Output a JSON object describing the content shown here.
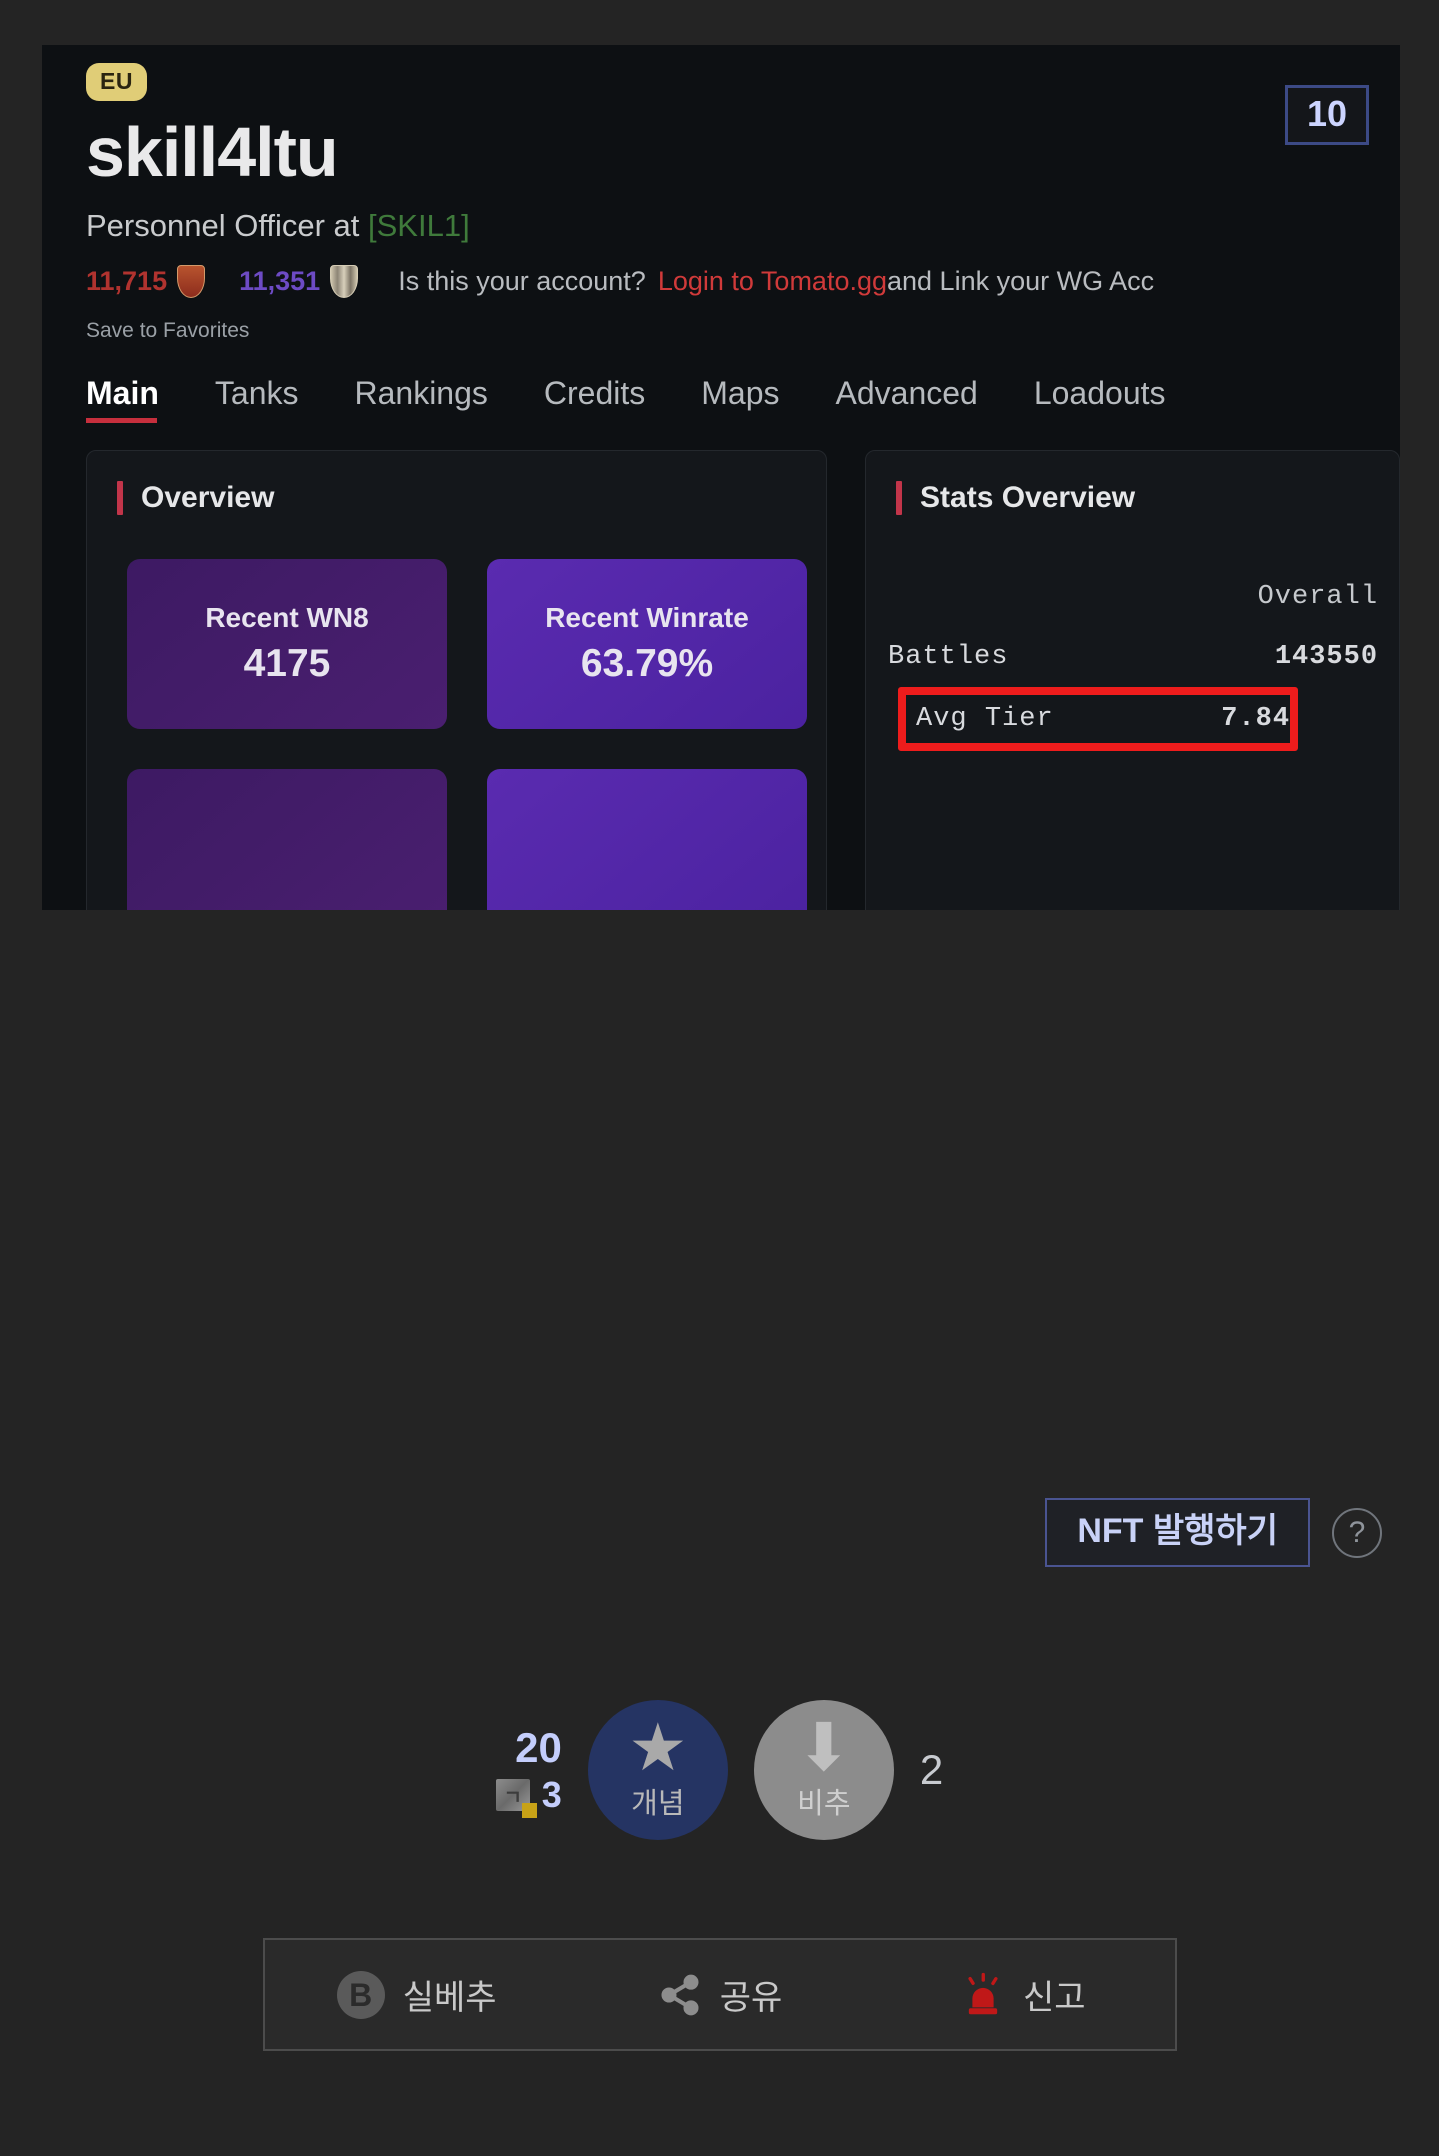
{
  "embedded_page": {
    "region_badge": "EU",
    "player_name": "skill4ltu",
    "role_prefix": "Personnel Officer at ",
    "clan_tag": "[SKIL1]",
    "wn8_value": "11,715",
    "winrate_value": "11,351",
    "account_question": "Is this your account?",
    "account_link": "Login to Tomato.gg",
    "account_rest": " and Link your WG Acc",
    "save_favorites": "Save to Favorites",
    "corner_number": "10",
    "tabs": [
      {
        "label": "Main",
        "active": true
      },
      {
        "label": "Tanks",
        "active": false
      },
      {
        "label": "Rankings",
        "active": false
      },
      {
        "label": "Credits",
        "active": false
      },
      {
        "label": "Maps",
        "active": false
      },
      {
        "label": "Advanced",
        "active": false
      },
      {
        "label": "Loadouts",
        "active": false
      }
    ],
    "overview_panel": {
      "title": "Overview",
      "tiles": [
        {
          "label": "Recent WN8",
          "value": "4175"
        },
        {
          "label": "Recent Winrate",
          "value": "63.79%"
        }
      ]
    },
    "stats_panel": {
      "title": "Stats Overview",
      "column_header": "Overall",
      "rows": [
        {
          "key": "Battles",
          "value": "143550",
          "highlighted": false
        },
        {
          "key": "Avg Tier",
          "value": "7.84",
          "highlighted": true
        }
      ]
    }
  },
  "nft": {
    "button_label": "NFT 발행하기",
    "help_glyph": "?"
  },
  "votes": {
    "up_count": "20",
    "sub_count": "3",
    "sub_icon_glyph": "ㄱ",
    "up_label": "개념",
    "down_label": "비추",
    "down_count": "2"
  },
  "action_bar": {
    "items": [
      {
        "icon": "b-badge-icon",
        "label": "실베추"
      },
      {
        "icon": "share-icon",
        "label": "공유"
      },
      {
        "icon": "siren-icon",
        "label": "신고"
      }
    ]
  },
  "colors": {
    "accent_red": "#c62f3d",
    "highlight_red": "#ee1c1c",
    "tile_purple": "#4b22a0",
    "vote_blue": "#253463",
    "region_gold": "#e0cd77",
    "link_red": "#d03a3a",
    "clan_green": "#3f7a3b"
  }
}
